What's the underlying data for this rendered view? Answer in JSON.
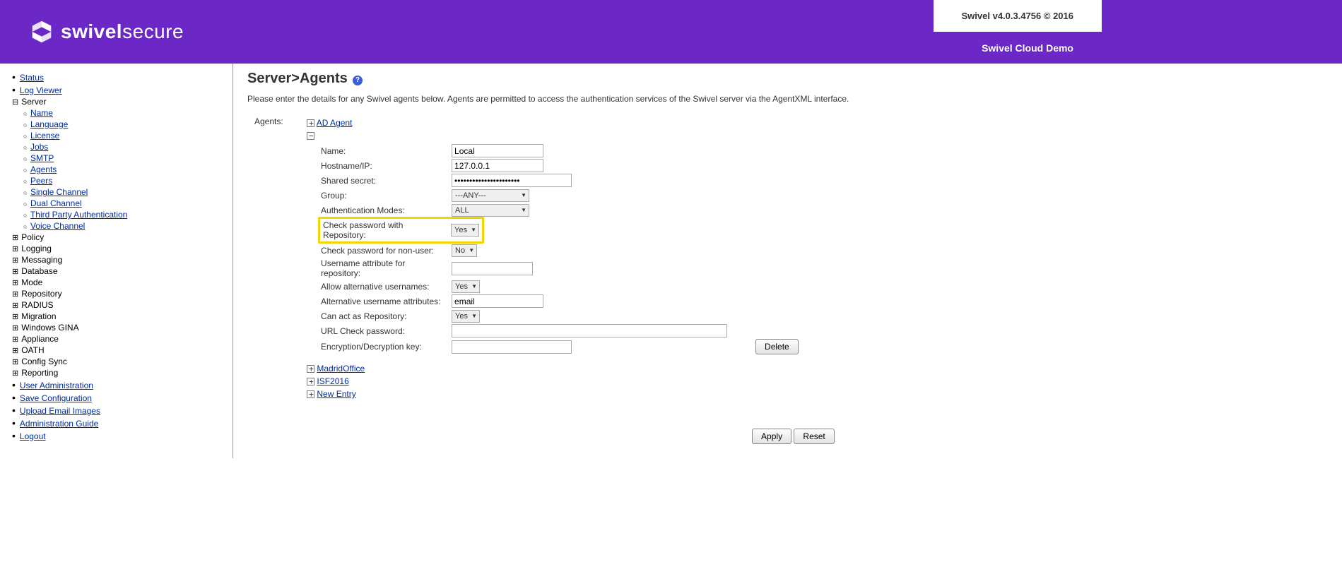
{
  "header": {
    "version": "Swivel v4.0.3.4756 © 2016",
    "cloud": "Swivel Cloud Demo"
  },
  "sidebar": {
    "status": "Status",
    "logviewer": "Log Viewer",
    "server": "Server",
    "server_sub": {
      "name": "Name",
      "language": "Language",
      "license": "License",
      "jobs": "Jobs",
      "smtp": "SMTP",
      "agents": "Agents",
      "peers": "Peers",
      "single": "Single Channel",
      "dual": "Dual Channel",
      "third": "Third Party Authentication",
      "voice": "Voice Channel"
    },
    "policy": "Policy",
    "logging": "Logging",
    "messaging": "Messaging",
    "database": "Database",
    "mode": "Mode",
    "repository": "Repository",
    "radius": "RADIUS",
    "migration": "Migration",
    "gina": "Windows GINA",
    "appliance": "Appliance",
    "oath": "OATH",
    "config": "Config Sync",
    "reporting": "Reporting",
    "useradmin": "User Administration",
    "saveconfig": "Save Configuration",
    "upload": "Upload Email Images",
    "adminguide": "Administration Guide",
    "logout": "Logout"
  },
  "page": {
    "title": "Server>Agents",
    "intro": "Please enter the details for any Swivel agents below. Agents are permitted to access the authentication services of the Swivel server via the AgentXML interface.",
    "agents_label": "Agents:",
    "collapsed": {
      "ad": "AD Agent",
      "madrid": "MadridOffice",
      "isf": "ISF2016",
      "new": "New Entry"
    },
    "form": {
      "name_l": "Name:",
      "name_v": "Local",
      "host_l": "Hostname/IP:",
      "host_v": "127.0.0.1",
      "secret_l": "Shared secret:",
      "secret_v": "••••••••••••••••••••••",
      "group_l": "Group:",
      "group_v": "---ANY---",
      "auth_l": "Authentication Modes:",
      "auth_v": "ALL",
      "chkrepo_l": "Check password with Repository:",
      "chkrepo_v": "Yes",
      "chknon_l": "Check password for non-user:",
      "chknon_v": "No",
      "userattr_l": "Username attribute for repository:",
      "userattr_v": "",
      "allowalt_l": "Allow alternative usernames:",
      "allowalt_v": "Yes",
      "altuser_l": "Alternative username attributes:",
      "altuser_v": "email",
      "canrepo_l": "Can act as Repository:",
      "canrepo_v": "Yes",
      "urlchk_l": "URL Check password:",
      "urlchk_v": "",
      "encdec_l": "Encryption/Decryption key:",
      "encdec_v": ""
    },
    "buttons": {
      "delete": "Delete",
      "apply": "Apply",
      "reset": "Reset"
    }
  }
}
